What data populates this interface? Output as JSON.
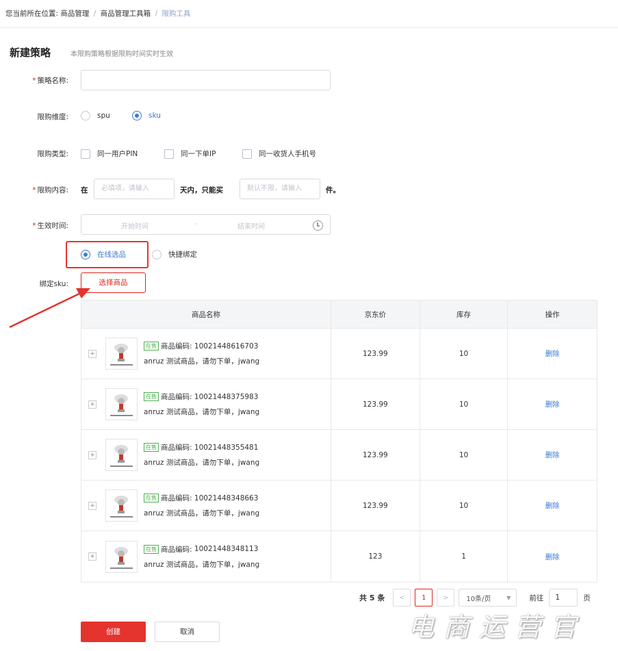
{
  "breadcrumb": {
    "prefix": "您当前所在位置:",
    "items": [
      "商品管理",
      "商品管理工具箱"
    ],
    "current": "限购工具",
    "separator": "/"
  },
  "page": {
    "title": "新建策略",
    "subtitle": "本限购策略根据限购时间实时生效"
  },
  "form": {
    "name": {
      "label": "策略名称:",
      "required": true,
      "value": ""
    },
    "dimension": {
      "label": "限购维度:",
      "options": [
        "spu",
        "sku"
      ],
      "selected": "sku"
    },
    "type": {
      "label": "限购类型:",
      "options": [
        "同一用户PIN",
        "同一下单IP",
        "同一收货人手机号"
      ]
    },
    "content": {
      "label": "限购内容:",
      "required": true,
      "prefix": "在",
      "days_placeholder": "必填项，请输入",
      "middle": "天内，只能买",
      "qty_placeholder": "默认不限，请输入",
      "suffix": "件。"
    },
    "effective_time": {
      "label": "生效时间:",
      "required": true,
      "start_placeholder": "开始时间",
      "separator": "-",
      "end_placeholder": "结束时间"
    },
    "select_mode": {
      "options": [
        "在线选品",
        "快捷绑定"
      ],
      "selected": "在线选品"
    },
    "bind_sku": {
      "label": "绑定sku:",
      "button": "选择商品"
    }
  },
  "table": {
    "columns": [
      "商品名称",
      "京东价",
      "库存",
      "操作"
    ],
    "rows": [
      {
        "status": "在售",
        "code_label": "商品编码:",
        "code": "10021448616703",
        "name": "anruz 测试商品，请勿下单，jwang",
        "price": "123.99",
        "stock": "10",
        "action": "删除"
      },
      {
        "status": "在售",
        "code_label": "商品编码:",
        "code": "10021448375983",
        "name": "anruz 测试商品，请勿下单，jwang",
        "price": "123.99",
        "stock": "10",
        "action": "删除"
      },
      {
        "status": "在售",
        "code_label": "商品编码:",
        "code": "10021448355481",
        "name": "anruz 测试商品，请勿下单，jwang",
        "price": "123.99",
        "stock": "10",
        "action": "删除"
      },
      {
        "status": "在售",
        "code_label": "商品编码:",
        "code": "10021448348663",
        "name": "anruz 测试商品，请勿下单，jwang",
        "price": "123.99",
        "stock": "10",
        "action": "删除"
      },
      {
        "status": "在售",
        "code_label": "商品编码:",
        "code": "10021448348113",
        "name": "anruz 测试商品，请勿下单，jwang",
        "price": "123",
        "stock": "1",
        "action": "删除"
      }
    ],
    "thumb_caption": "测试商品 请勿下单"
  },
  "pagination": {
    "total": "共 5 条",
    "prev": "<",
    "current_page": "1",
    "next": ">",
    "page_size": "10条/页",
    "goto_prefix": "前往",
    "goto_value": "1",
    "goto_suffix": "页"
  },
  "actions": {
    "create": "创建",
    "cancel": "取消"
  },
  "watermark": "电商运营官",
  "colors": {
    "accent_red": "#e1251b",
    "link_blue": "#3a7bd5",
    "tag_green": "#4cb050"
  }
}
